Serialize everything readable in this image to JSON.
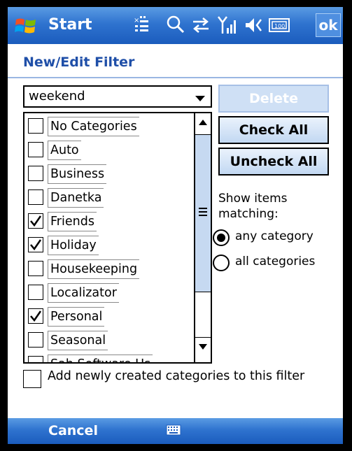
{
  "topbar": {
    "start_label": "Start",
    "ok_label": "ok",
    "icons": [
      "windows-logo",
      "new-message-icon",
      "search-icon",
      "sync-icon",
      "signal-icon",
      "volume-icon",
      "battery-icon"
    ]
  },
  "page": {
    "title": "New/Edit Filter"
  },
  "filter_combo": {
    "value": "weekend"
  },
  "categories": [
    {
      "label": "No Categories",
      "checked": false
    },
    {
      "label": "Auto",
      "checked": false
    },
    {
      "label": "Business",
      "checked": false
    },
    {
      "label": "Danetka",
      "checked": false
    },
    {
      "label": "Friends",
      "checked": true
    },
    {
      "label": "Holiday",
      "checked": true
    },
    {
      "label": "Housekeeping",
      "checked": false
    },
    {
      "label": "Localizator",
      "checked": false
    },
    {
      "label": "Personal",
      "checked": true
    },
    {
      "label": "Seasonal",
      "checked": false
    },
    {
      "label": "Sah Software Us",
      "checked": false
    }
  ],
  "buttons": {
    "delete_label": "Delete",
    "check_all_label": "Check All",
    "uncheck_all_label": "Uncheck All"
  },
  "matching": {
    "label": "Show items matching:",
    "label_line1": "Show items",
    "label_line2": "matching:",
    "options": [
      {
        "label": "any category",
        "selected": true
      },
      {
        "label": "all categories",
        "selected": false
      }
    ]
  },
  "add_new": {
    "label": "Add newly created categories to this filter",
    "checked": false
  },
  "bottombar": {
    "cancel_label": "Cancel"
  },
  "colors": {
    "bar_blue": "#2f73cf",
    "title_blue": "#1f4fa8",
    "scroll_thumb": "#c6d9f1"
  }
}
